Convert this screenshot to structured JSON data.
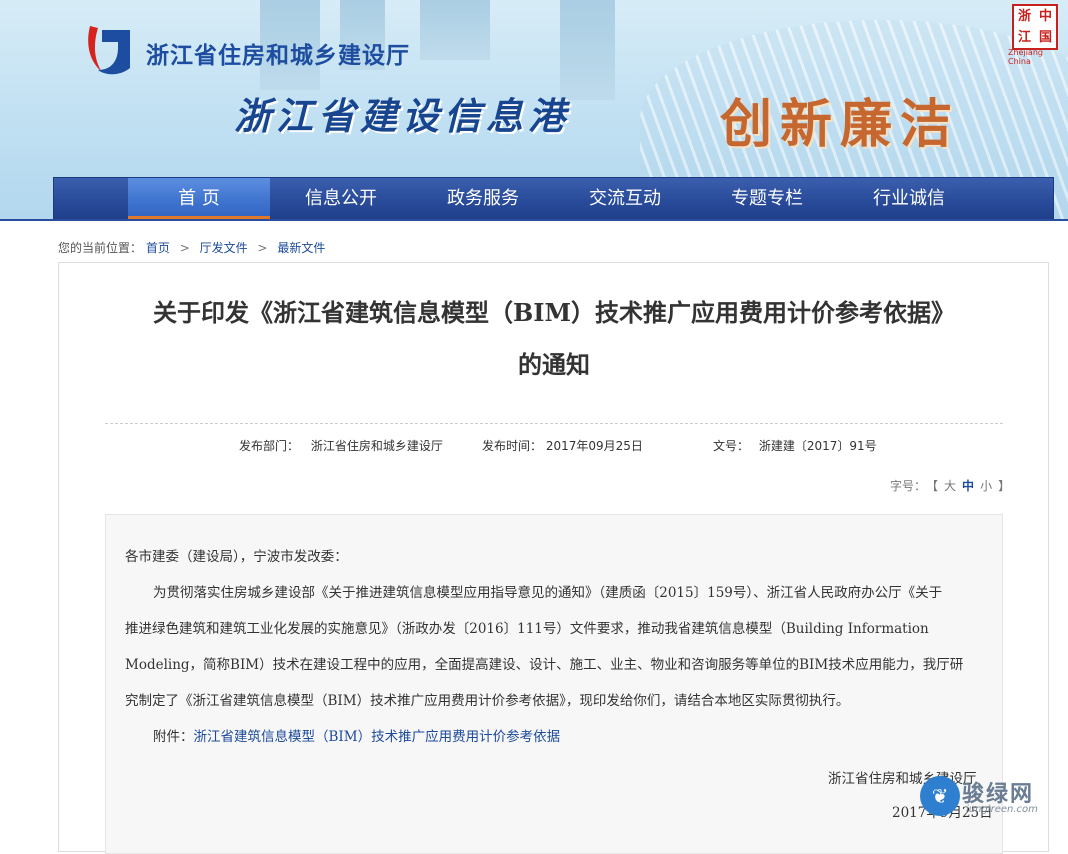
{
  "header": {
    "org_name": "浙江省住房和城乡建设厅",
    "site_name": "浙江省建设信息港",
    "slogan": "创新廉洁",
    "seal": {
      "chars": [
        "浙",
        "中",
        "江",
        "国"
      ],
      "caption": "Zhejiang China"
    },
    "colors": {
      "brand_blue": "#1d4da0",
      "nav_blue": "#2a4d9c",
      "slogan": "#c5672f",
      "seal_red": "#c8211d"
    }
  },
  "nav": {
    "items": [
      {
        "label": "首 页",
        "active": true
      },
      {
        "label": "信息公开",
        "active": false
      },
      {
        "label": "政务服务",
        "active": false
      },
      {
        "label": "交流互动",
        "active": false
      },
      {
        "label": "专题专栏",
        "active": false
      },
      {
        "label": "行业诚信",
        "active": false
      }
    ]
  },
  "breadcrumb": {
    "prefix": "您的当前位置：",
    "items": [
      "首页",
      "厅发文件",
      "最新文件"
    ],
    "separator": ">"
  },
  "article": {
    "title_line1": "关于印发《浙江省建筑信息模型（BIM）技术推广应用费用计价参考依据》",
    "title_line2": "的通知",
    "meta": {
      "dept_label": "发布部门：",
      "dept_value": "浙江省住房和城乡建设厅",
      "time_label": "发布时间：",
      "time_value": "2017年09月25日",
      "doc_label": "文号：",
      "doc_value": "浙建建〔2017〕91号"
    },
    "font_size": {
      "label": "字号：",
      "open": "【",
      "large": "大",
      "medium": "中",
      "small": "小",
      "close": "】"
    },
    "body": {
      "salutation": "各市建委（建设局），宁波市发改委：",
      "para1_line1": "为贯彻落实住房城乡建设部《关于推进建筑信息模型应用指导意见的通知》（建质函〔2015〕159号）、浙江省人民政府办公厅《关于",
      "para1_line2": "推进绿色建筑和建筑工业化发展的实施意见》（浙政办发〔2016〕111号）文件要求，推动我省建筑信息模型（Building Information",
      "para1_line3": "Modeling，简称BIM）技术在建设工程中的应用，全面提高建设、设计、施工、业主、物业和咨询服务等单位的BIM技术应用能力，我厅研",
      "para1_line4": "究制定了《浙江省建筑信息模型（BIM）技术推广应用费用计价参考依据》，现印发给你们，请结合本地区实际贯彻执行。",
      "attach_label": "附件：",
      "attach_link": "浙江省建筑信息模型（BIM）技术推广应用费用计价参考依据",
      "signer": "浙江省住房和城乡建设厅",
      "date": "2017年9月25日"
    }
  },
  "watermark": {
    "text": "骏绿网",
    "sub": "junglreen.com"
  }
}
